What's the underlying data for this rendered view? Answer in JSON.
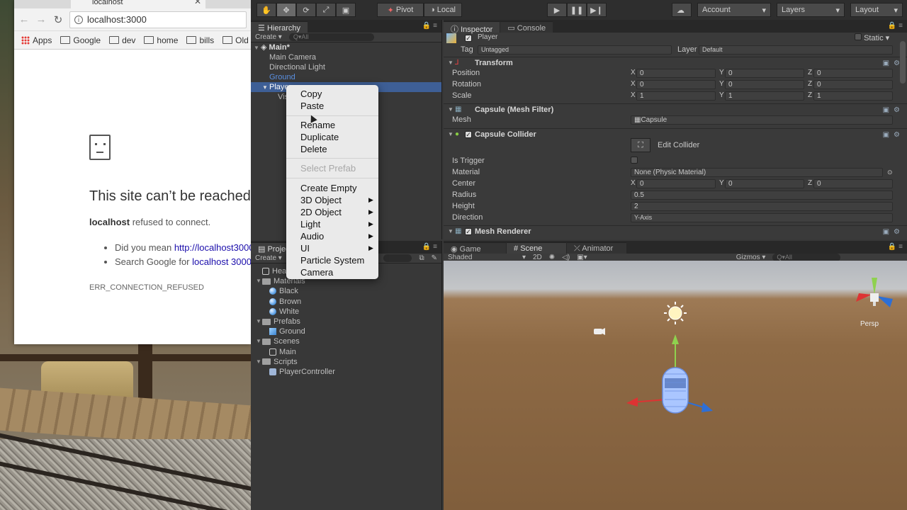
{
  "browser": {
    "tab_title": "localhost",
    "url": "localhost:3000",
    "bookmarks": [
      "Apps",
      "Google",
      "dev",
      "home",
      "bills",
      "Old"
    ],
    "error_title": "This site can’t be reached",
    "error_host": "localhost",
    "error_sub": " refused to connect.",
    "suggest_prefix": "Did you mean ",
    "suggest_link": "http://localhost3000",
    "search_prefix": "Search Google for ",
    "search_link": "localhost 3000",
    "error_code": "ERR_CONNECTION_REFUSED"
  },
  "toolbar": {
    "pivot": "Pivot",
    "local": "Local",
    "account": "Account",
    "layers": "Layers",
    "layout": "Layout"
  },
  "hierarchy": {
    "tab": "Hierarchy",
    "create": "Create",
    "search_placeholder": "Q▾All",
    "scene": "Main*",
    "items": [
      "Main Camera",
      "Directional Light",
      "Ground",
      "Player",
      "Vis"
    ]
  },
  "project": {
    "tab": "Project",
    "create": "Create",
    "items": [
      {
        "label": "Health",
        "type": "unity",
        "depth": 0
      },
      {
        "label": "Materials",
        "type": "folder",
        "depth": 0
      },
      {
        "label": "Black",
        "type": "ball",
        "depth": 1
      },
      {
        "label": "Brown",
        "type": "ball",
        "depth": 1
      },
      {
        "label": "White",
        "type": "ball",
        "depth": 1
      },
      {
        "label": "Prefabs",
        "type": "folder",
        "depth": 0
      },
      {
        "label": "Ground",
        "type": "cube",
        "depth": 1
      },
      {
        "label": "Scenes",
        "type": "folder",
        "depth": 0
      },
      {
        "label": "Main",
        "type": "unity",
        "depth": 1
      },
      {
        "label": "Scripts",
        "type": "folder",
        "depth": 0
      },
      {
        "label": "PlayerController",
        "type": "script",
        "depth": 1
      }
    ]
  },
  "inspector": {
    "tab": "Inspector",
    "console_tab": "Console",
    "object_name": "Player",
    "static": "Static",
    "tag_label": "Tag",
    "tag_value": "Untagged",
    "layer_label": "Layer",
    "layer_value": "Default",
    "transform": {
      "title": "Transform",
      "position_label": "Position",
      "position": [
        "0",
        "0",
        "0"
      ],
      "rotation_label": "Rotation",
      "rotation": [
        "0",
        "0",
        "0"
      ],
      "scale_label": "Scale",
      "scale": [
        "1",
        "1",
        "1"
      ]
    },
    "mesh_filter": {
      "title": "Capsule (Mesh Filter)",
      "mesh_label": "Mesh",
      "mesh_value": "Capsule"
    },
    "collider": {
      "title": "Capsule Collider",
      "edit_button": "Edit Collider",
      "is_trigger_label": "Is Trigger",
      "material_label": "Material",
      "material_value": "None (Physic Material)",
      "center_label": "Center",
      "center": [
        "0",
        "0",
        "0"
      ],
      "radius_label": "Radius",
      "radius": "0.5",
      "height_label": "Height",
      "height": "2",
      "direction_label": "Direction",
      "direction": "Y-Axis"
    },
    "mesh_renderer": {
      "title": "Mesh Renderer"
    }
  },
  "scene": {
    "tabs": [
      "Game",
      "Scene",
      "Animator"
    ],
    "shaded": "Shaded",
    "mode_2d": "2D",
    "gizmos": "Gizmos",
    "search_placeholder": "Q▾All",
    "persp": "Persp"
  },
  "context_menu": {
    "items": [
      {
        "label": "Copy",
        "enabled": true,
        "submenu": false
      },
      {
        "label": "Paste",
        "enabled": true,
        "submenu": false
      },
      {
        "label": "Rename",
        "enabled": true,
        "submenu": false
      },
      {
        "label": "Duplicate",
        "enabled": true,
        "submenu": false
      },
      {
        "label": "Delete",
        "enabled": true,
        "submenu": false
      },
      {
        "label": "Select Prefab",
        "enabled": false,
        "submenu": false
      },
      {
        "label": "Create Empty",
        "enabled": true,
        "submenu": false
      },
      {
        "label": "3D Object",
        "enabled": true,
        "submenu": true
      },
      {
        "label": "2D Object",
        "enabled": true,
        "submenu": true
      },
      {
        "label": "Light",
        "enabled": true,
        "submenu": true
      },
      {
        "label": "Audio",
        "enabled": true,
        "submenu": true
      },
      {
        "label": "UI",
        "enabled": true,
        "submenu": true
      },
      {
        "label": "Particle System",
        "enabled": true,
        "submenu": false
      },
      {
        "label": "Camera",
        "enabled": true,
        "submenu": false
      }
    ]
  },
  "colors": {
    "selection": "#3e5f96",
    "unity_bg": "#383838",
    "link": "#1a0dab",
    "ground": "#8e6a45"
  }
}
